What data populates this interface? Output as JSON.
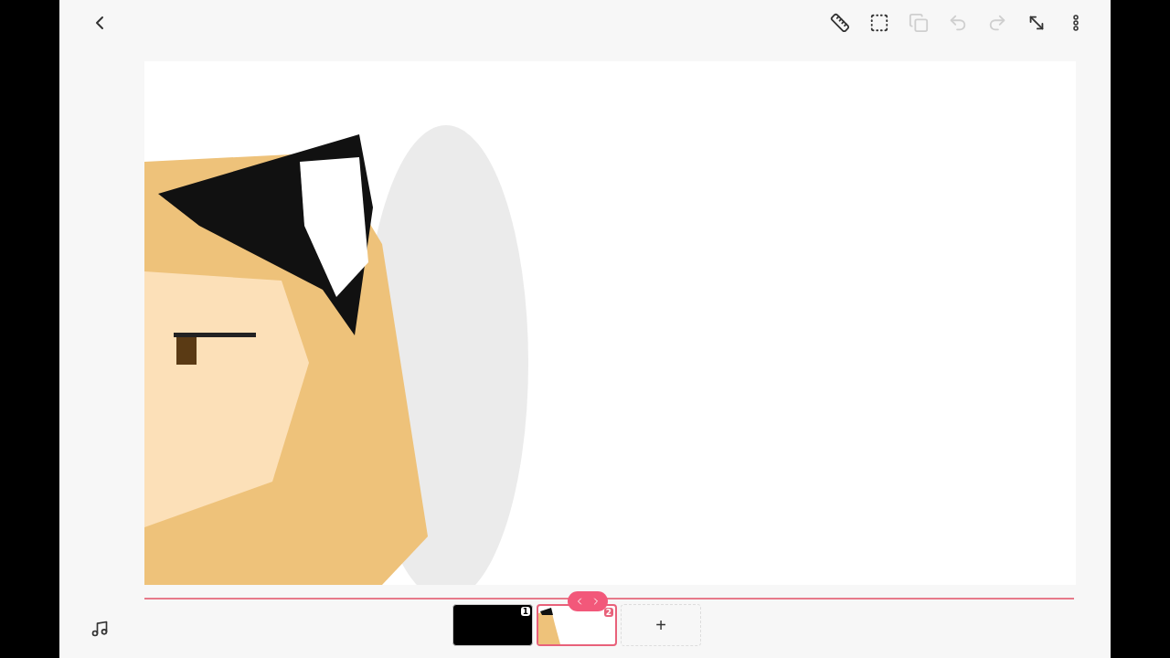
{
  "toolbar": [
    {
      "kind": "ruler",
      "disabled": false
    },
    {
      "kind": "select",
      "disabled": false
    },
    {
      "kind": "copy",
      "disabled": true
    },
    {
      "kind": "undo",
      "disabled": true
    },
    {
      "kind": "redo",
      "disabled": true
    },
    {
      "kind": "expand",
      "disabled": false
    },
    {
      "kind": "more",
      "disabled": false
    }
  ],
  "frames": [
    {
      "number": "1",
      "kind": "black",
      "selected": false
    },
    {
      "number": "2",
      "kind": "drawing",
      "selected": true
    }
  ],
  "add_frame": "+"
}
